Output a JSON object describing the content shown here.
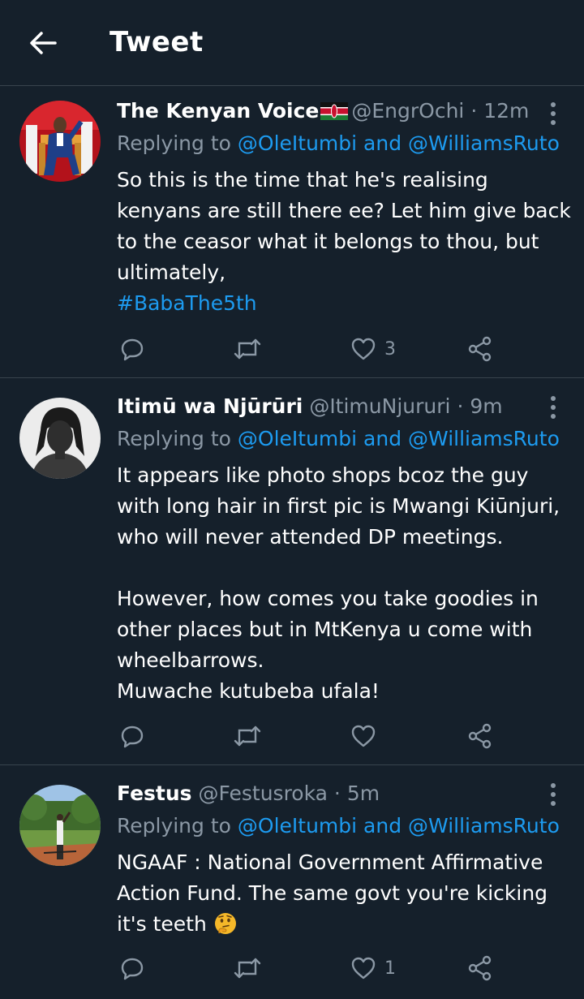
{
  "header": {
    "title": "Tweet"
  },
  "tweets": [
    {
      "name": "The Kenyan Voice",
      "handle": "@EngrOchi",
      "time": "· 12m",
      "reply_prefix": "Replying to",
      "reply_to": "@OleItumbi and @WilliamsRuto",
      "body": [
        "So this is the time that he's realising kenyans are still there ee? Let him give back to the ceasor what it belongs to thou, but ultimately,"
      ],
      "hashtag": "#BabaThe5th",
      "likes": "3"
    },
    {
      "name": "Itimū wa Njūrūri",
      "handle": "@ItimuNjururi",
      "time": "· 9m",
      "reply_prefix": "Replying to",
      "reply_to": "@OleItumbi and @WilliamsRuto",
      "body": [
        "It appears like photo shops bcoz the guy with long hair in first pic is Mwangi Kiūnjuri, who will never attended DP meetings.",
        "However, how comes you take goodies in other places but in MtKenya u come with wheelbarrows.",
        "Muwache kutubeba ufala!"
      ],
      "likes": ""
    },
    {
      "name": "Festus",
      "handle": "@Festusroka",
      "time": "· 5m",
      "reply_prefix": "Replying to",
      "reply_to": "@OleItumbi and @WilliamsRuto",
      "body": [
        "NGAAF : National Government Affirmative Action Fund. The same govt you're kicking it's teeth"
      ],
      "emoji": "thinking-face",
      "likes": "1"
    }
  ],
  "colors": {
    "background": "#15202b",
    "text": "#ffffff",
    "secondary": "#8b98a5",
    "link": "#1d9bf0",
    "divider": "#38444d"
  },
  "icons": [
    "back-arrow-icon",
    "more-icon",
    "reply-icon",
    "retweet-icon",
    "like-icon",
    "share-icon",
    "kenya-flag-icon",
    "thinking-face-emoji"
  ]
}
